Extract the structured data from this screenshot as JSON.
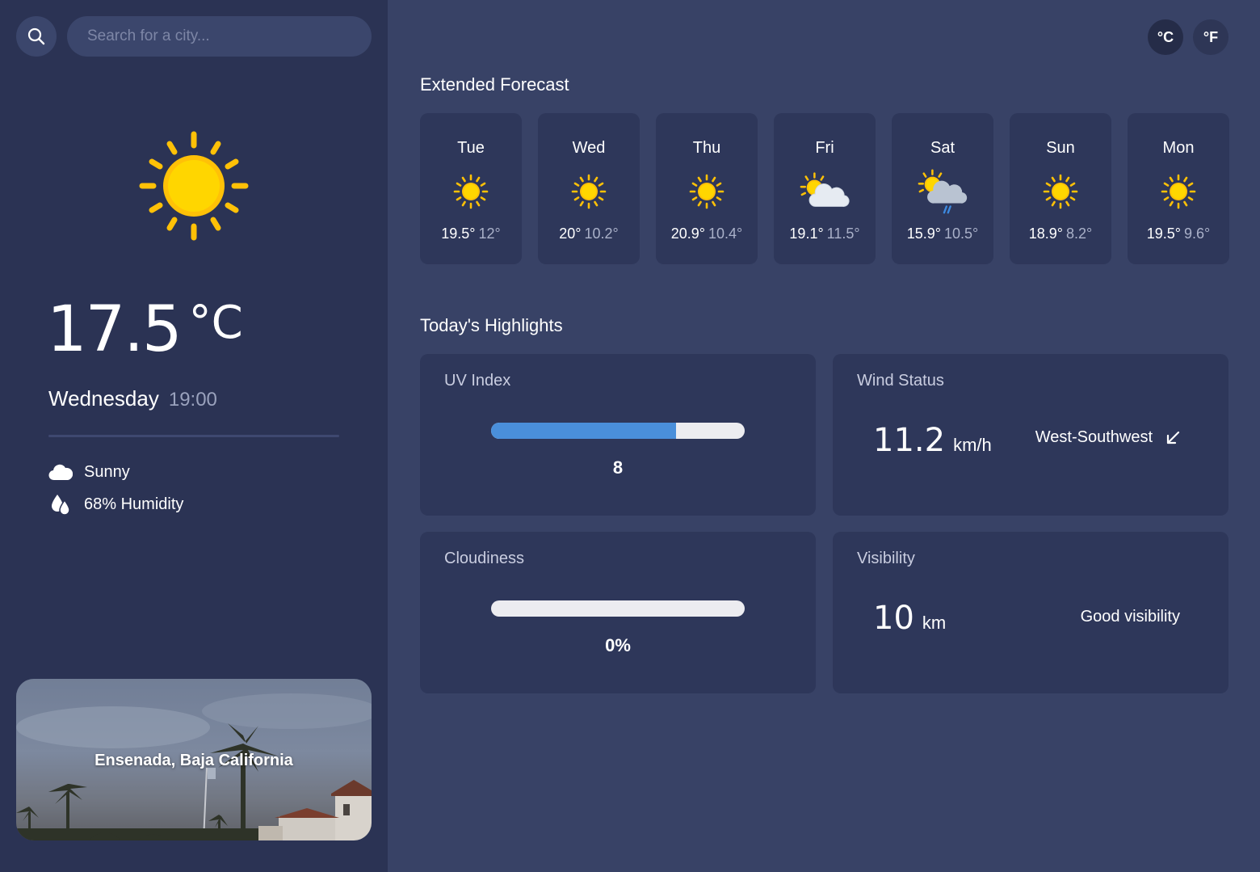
{
  "search": {
    "placeholder": "Search for a city..."
  },
  "current": {
    "temperature": "17.5",
    "unit": "°C",
    "day": "Wednesday",
    "time": "19:00",
    "condition": "Sunny",
    "humidity": "68% Humidity",
    "icon": "sun-icon"
  },
  "location": {
    "name": "Ensenada, Baja California"
  },
  "units": {
    "celsius": "°C",
    "fahrenheit": "°F"
  },
  "forecast": {
    "title": "Extended Forecast",
    "days": [
      {
        "day": "Tue",
        "max": "19.5°",
        "min": "12°",
        "icon": "sun-icon"
      },
      {
        "day": "Wed",
        "max": "20°",
        "min": "10.2°",
        "icon": "sun-icon"
      },
      {
        "day": "Thu",
        "max": "20.9°",
        "min": "10.4°",
        "icon": "sun-icon"
      },
      {
        "day": "Fri",
        "max": "19.1°",
        "min": "11.5°",
        "icon": "partly-cloudy-icon"
      },
      {
        "day": "Sat",
        "max": "15.9°",
        "min": "10.5°",
        "icon": "cloud-rain-sun-icon"
      },
      {
        "day": "Sun",
        "max": "18.9°",
        "min": "8.2°",
        "icon": "sun-icon"
      },
      {
        "day": "Mon",
        "max": "19.5°",
        "min": "9.6°",
        "icon": "sun-icon"
      }
    ]
  },
  "highlights": {
    "title": "Today's Highlights",
    "uv": {
      "label": "UV Index",
      "value": "8",
      "level": 0.73
    },
    "wind": {
      "label": "Wind Status",
      "speed": "11.2",
      "unit": "km/h",
      "direction": "West-Southwest",
      "icon": "arrow-down-left-icon"
    },
    "cloudiness": {
      "label": "Cloudiness",
      "value": "0%",
      "level": 0
    },
    "visibility": {
      "label": "Visibility",
      "value": "10",
      "unit": "km",
      "description": "Good visibility"
    }
  },
  "colors": {
    "background": "#384266",
    "sidebar": "#2b3354",
    "card": "#2e375a",
    "bar_fill": "#4a8fdb",
    "bar_track": "#ececf0",
    "sun": "#ffc107"
  }
}
